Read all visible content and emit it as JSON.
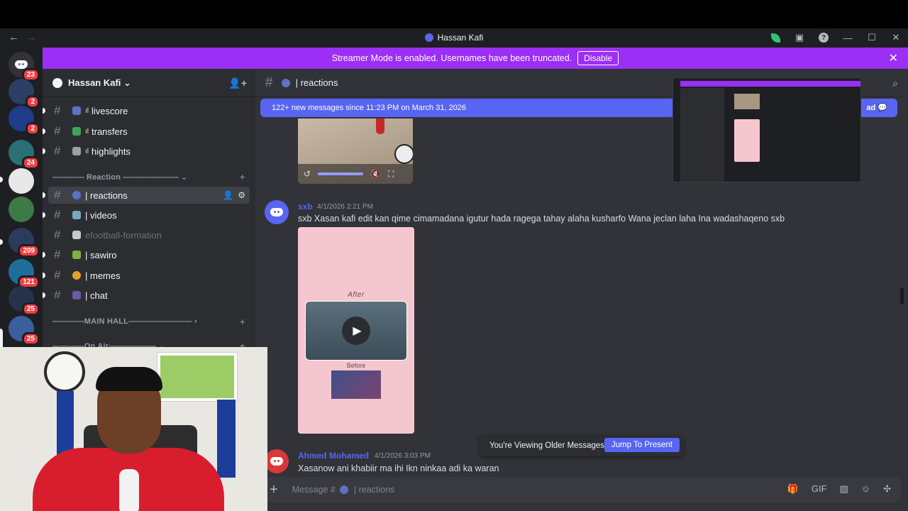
{
  "window": {
    "title": "Hassan Kafi"
  },
  "banner": {
    "text": "Streamer Mode is enabled. Usernames have been truncated.",
    "disable_label": "Disable"
  },
  "servers": {
    "badges": [
      "23",
      "2",
      "2",
      "24",
      "209",
      "121",
      "25",
      "25"
    ]
  },
  "guild": {
    "name": "Hassan Kafi ⌄"
  },
  "channels": {
    "top": [
      {
        "name": "livescore",
        "emoji_color": "#5b73c4"
      },
      {
        "name": "transfers",
        "emoji_color": "#3ba55d"
      },
      {
        "name": "highlights",
        "emoji_color": "#9aa0a6"
      }
    ],
    "category_reaction": "———— Reaction ——————— ⌄",
    "reaction": [
      {
        "name": "| reactions",
        "emoji_color": "#5b73c4"
      },
      {
        "name": "| videos",
        "emoji_color": "#7aa6c2"
      },
      {
        "name": "efootball-formation",
        "emoji_color": "#c8c8c8"
      },
      {
        "name": "| sawiro",
        "emoji_color": "#7cb342"
      },
      {
        "name": "| memes",
        "emoji_color": "#e0a32a"
      },
      {
        "name": "| chat",
        "emoji_color": "#6e59a5"
      }
    ],
    "category_main_hall": "————MAIN HALL———————— ›",
    "category_on_air": "————On Air—————— ⌄"
  },
  "header": {
    "channel": "| reactions"
  },
  "new_messages": {
    "text": "122+ new messages since 11:23 PM on March 31, 2026",
    "mark_label": "ad"
  },
  "messages": [
    {
      "author": "sxb",
      "timestamp": "4/1/2026 2:21 PM",
      "text": "sxb Xasan kafi edit kan qime cimamadana igutur hada ragega tahay alaha kusharfo Wana jeclan laha Ina wadashaqeno sxb",
      "attachment": {
        "after_label": "After",
        "before_label": "Before"
      }
    },
    {
      "author": "Ahmed Mohamed",
      "timestamp": "4/1/2026 3:03 PM",
      "text": "Xasanow ani khabiir ma ihi Ikn ninkaa adi ka waran"
    }
  ],
  "older_notice": {
    "text": "You're Viewing Older Messages",
    "jump_label": "Jump To Present"
  },
  "composer": {
    "placeholder": "Message #",
    "channel_hint": "| reactions"
  },
  "colors": {
    "accent": "#5865f2",
    "streamer_banner": "#9b2ff5",
    "badge": "#f23f43"
  }
}
